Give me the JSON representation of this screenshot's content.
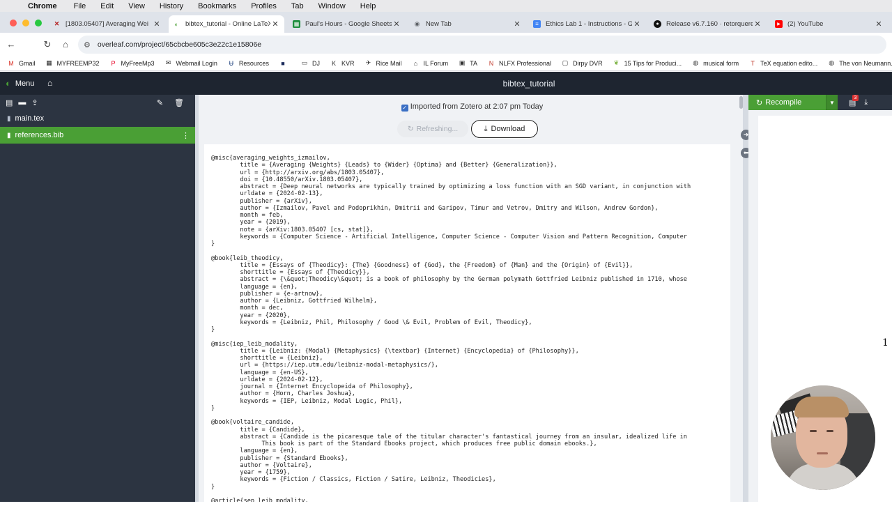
{
  "mac_menu": {
    "app": "Chrome",
    "items": [
      "File",
      "Edit",
      "View",
      "History",
      "Bookmarks",
      "Profiles",
      "Tab",
      "Window",
      "Help"
    ]
  },
  "tabs": [
    {
      "title": "[1803.05407] Averaging Wei",
      "icon": "arxiv-icon",
      "color": "#b31b1b"
    },
    {
      "title": "bibtex_tutorial - Online LaTeX",
      "icon": "overleaf-icon",
      "color": "#4a9f35"
    },
    {
      "title": "Paul's Hours - Google Sheets",
      "icon": "sheets-icon",
      "color": "#1e8e3e"
    },
    {
      "title": "New Tab",
      "icon": "chrome-icon",
      "color": "#5f6368"
    },
    {
      "title": "Ethics Lab 1 - Instructions - G",
      "icon": "docs-icon",
      "color": "#4285f4"
    },
    {
      "title": "Release v6.7.160 · retorquere",
      "icon": "github-icon",
      "color": "#111111"
    },
    {
      "title": "(2) YouTube",
      "icon": "youtube-icon",
      "color": "#ff0000"
    }
  ],
  "address": {
    "url": "overleaf.com/project/65cbcbe605c3e22c1e15806e"
  },
  "bookmarks": [
    {
      "label": "Gmail",
      "icon": "gmail-icon",
      "color": "#d93025"
    },
    {
      "label": "MYFREEMP32",
      "icon": "folder-dark-icon",
      "color": "#222222"
    },
    {
      "label": "MyFreeMp3",
      "icon": "pinterest-icon",
      "color": "#e60023"
    },
    {
      "label": "Webmail Login",
      "icon": "mail-icon",
      "color": "#333333"
    },
    {
      "label": "Resources",
      "icon": "rice-icon",
      "color": "#1a3d7a"
    },
    {
      "label": "",
      "icon": "square-icon",
      "color": "#1a2a5a"
    },
    {
      "label": "DJ",
      "icon": "folder-icon",
      "color": "#444444"
    },
    {
      "label": "KVR",
      "icon": "kvr-icon",
      "color": "#333333"
    },
    {
      "label": "Rice Mail",
      "icon": "rice-mail-icon",
      "color": "#333333"
    },
    {
      "label": "IL Forum",
      "icon": "forum-icon",
      "color": "#333333"
    },
    {
      "label": "TA",
      "icon": "ta-icon",
      "color": "#333333"
    },
    {
      "label": "NLFX Professional",
      "icon": "nlfx-icon",
      "color": "#c0392b"
    },
    {
      "label": "Dirpy DVR",
      "icon": "dvr-icon",
      "color": "#333333"
    },
    {
      "label": "15 Tips for Produci...",
      "icon": "leaf-icon",
      "color": "#7cb342"
    },
    {
      "label": "musical form",
      "icon": "globe-icon",
      "color": "#333333"
    },
    {
      "label": "TeX equation edito...",
      "icon": "tex-icon",
      "color": "#c0392b"
    },
    {
      "label": "The von Neumann...",
      "icon": "globe-icon",
      "color": "#333333"
    }
  ],
  "overleaf": {
    "menu_label": "Menu",
    "project_title": "bibtex_tutorial"
  },
  "files": [
    {
      "name": "main.tex",
      "active": false
    },
    {
      "name": "references.bib",
      "active": true
    }
  ],
  "editor": {
    "zotero_status": "Imported from Zotero at 2:07 pm Today",
    "refresh_label": "Refreshing...",
    "download_label": "Download",
    "code": "@misc{averaging_weights_izmailov,\n\ttitle = {Averaging {Weights} {Leads} to {Wider} {Optima} and {Better} {Generalization}},\n\turl = {http://arxiv.org/abs/1803.05407},\n\tdoi = {10.48550/arXiv.1803.05407},\n\tabstract = {Deep neural networks are typically trained by optimizing a loss function with an SGD variant, in conjunction with\n\turldate = {2024-02-13},\n\tpublisher = {arXiv},\n\tauthor = {Izmailov, Pavel and Podoprikhin, Dmitrii and Garipov, Timur and Vetrov, Dmitry and Wilson, Andrew Gordon},\n\tmonth = feb,\n\tyear = {2019},\n\tnote = {arXiv:1803.05407 [cs, stat]},\n\tkeywords = {Computer Science - Artificial Intelligence, Computer Science - Computer Vision and Pattern Recognition, Computer\n}\n\n@book{leib_theodicy,\n\ttitle = {Essays of {Theodicy}: {The} {Goodness} of {God}, the {Freedom} of {Man} and the {Origin} of {Evil}},\n\tshorttitle = {Essays of {Theodicy}},\n\tabstract = {\\&quot;Theodicy\\&quot; is a book of philosophy by the German polymath Gottfried Leibniz published in 1710, whose\n\tlanguage = {en},\n\tpublisher = {e-artnow},\n\tauthor = {Leibniz, Gottfried Wilhelm},\n\tmonth = dec,\n\tyear = {2020},\n\tkeywords = {Leibniz, Phil, Philosophy / Good \\& Evil, Problem of Evil, Theodicy},\n}\n\n@misc{iep_leib_modality,\n\ttitle = {Leibniz: {Modal} {Metaphysics} {\\textbar} {Internet} {Encyclopedia} of {Philosophy}},\n\tshorttitle = {Leibniz},\n\turl = {https://iep.utm.edu/leibniz-modal-metaphysics/},\n\tlanguage = {en-US},\n\turldate = {2024-02-12},\n\tjournal = {Internet Encyclopeida of Philosophy},\n\tauthor = {Horn, Charles Joshua},\n\tkeywords = {IEP, Leibniz, Modal Logic, Phil},\n}\n\n@book{voltaire_candide,\n\ttitle = {Candide},\n\tabstract = {Candide is the picaresque tale of the titular character's fantastical journey from an insular, idealized life in\n\t      This book is part of the Standard Ebooks project, which produces free public domain ebooks.},\n\tlanguage = {en},\n\tpublisher = {Standard Ebooks},\n\tauthor = {Voltaire},\n\tyear = {1759},\n\tkeywords = {Fiction / Classics, Fiction / Satire, Leibniz, Theodicies},\n}\n\n@article{sep_leib_modality,"
  },
  "pdf": {
    "recompile_label": "Recompile",
    "error_count": "3",
    "page_number": "1"
  },
  "colors": {
    "overleaf_green": "#4a9f35",
    "overleaf_dark": "#1e2530",
    "filetree_bg": "#2c3441"
  }
}
